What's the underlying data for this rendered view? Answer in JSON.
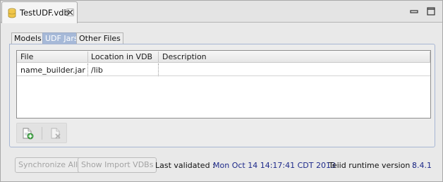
{
  "editor_tab": {
    "title": "TestUDF.vdb"
  },
  "inner_tabs": [
    {
      "label": "Models"
    },
    {
      "label": "UDF Jars"
    },
    {
      "label": "Other Files"
    }
  ],
  "table": {
    "columns": [
      "File",
      "Location in VDB",
      "Description"
    ],
    "rows": [
      {
        "file": "name_builder.jar",
        "location": "/lib",
        "description": ""
      }
    ]
  },
  "toolbar": {
    "add_icon": "add-jar-icon",
    "remove_icon": "remove-jar-icon"
  },
  "status": {
    "synchronize_label": "Synchronize All",
    "show_import_label": "Show Import VDBs",
    "last_validated_label": "Last validated :",
    "last_validated_value": "Mon Oct 14 14:17:41 CDT 2013",
    "runtime_label": "Teiid runtime version :",
    "runtime_value": "8.4.1"
  },
  "colors": {
    "active_tab": "#a6b9d8",
    "value_text": "#1e2a8a"
  }
}
